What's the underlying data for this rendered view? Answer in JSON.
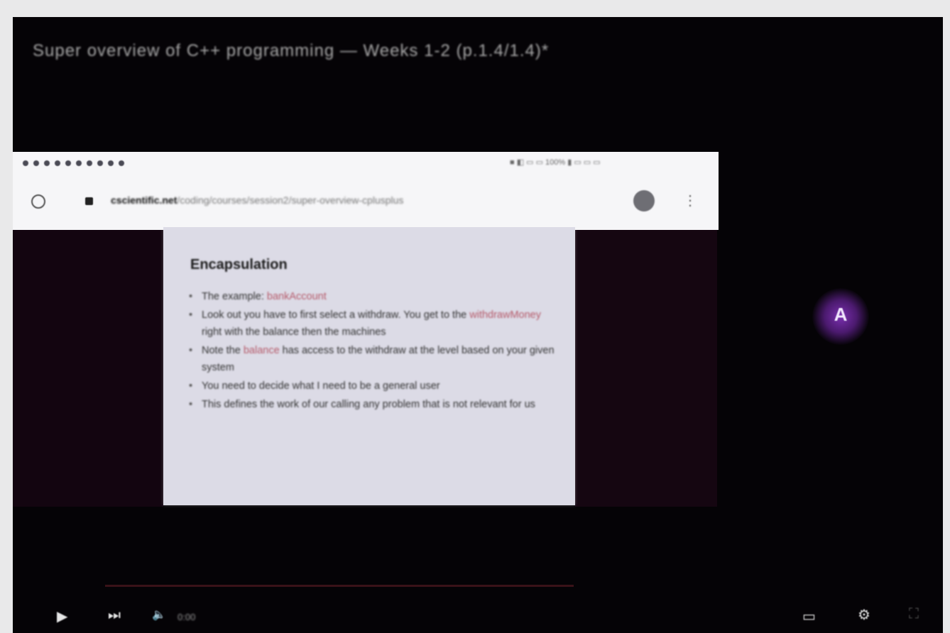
{
  "video": {
    "title": "Super overview of C++ programming — Weeks 1-2 (p.1.4/1.4)*"
  },
  "inner_browser": {
    "tab_strip_text": "■ ◧ ▭ ▭ 100% ▮ ▭ ▭ ▭",
    "url_domain": "cscientific.net",
    "url_path": "/coding/courses/session2/super-overview-cplusplus"
  },
  "slide": {
    "title": "Encapsulation",
    "bullets": [
      {
        "pre": "The example: ",
        "hl": "bankAccount",
        "post": ""
      },
      {
        "pre": "Look out you have to first select a withdraw. You get to the ",
        "hl": "withdrawMoney",
        "post": " right with the balance then the machines"
      },
      {
        "pre": "Note the ",
        "hl": "balance",
        "post": " has access to the withdraw at the level based on your given system"
      },
      {
        "pre": "You need to decide what I need to be a general user",
        "hl": "",
        "post": ""
      },
      {
        "pre": "This defines the work of our calling any problem that is not",
        "hl": "",
        "post": " relevant for us"
      }
    ]
  },
  "avatar": {
    "letter": "A",
    "color": "#7a2fb0"
  },
  "player": {
    "time": "0:00",
    "progress": 0.0
  }
}
